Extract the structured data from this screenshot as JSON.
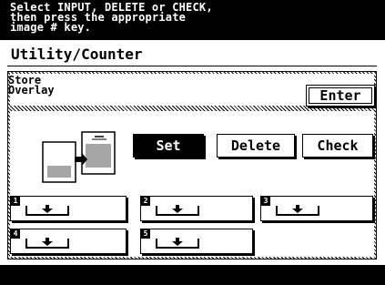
{
  "banner": {
    "line1": "Select INPUT, DELETE or CHECK,",
    "line2": "then press the appropriate",
    "line3": "image # key."
  },
  "header": {
    "title": "Utility/Counter"
  },
  "breadcrumb": {
    "line1": "Store",
    "line2": "Overlay"
  },
  "buttons": {
    "enter": "Enter",
    "set": "Set",
    "delete": "Delete",
    "check": "Check"
  },
  "image_keys": [
    "1",
    "2",
    "3",
    "4",
    "5"
  ],
  "selected_action": "Set"
}
